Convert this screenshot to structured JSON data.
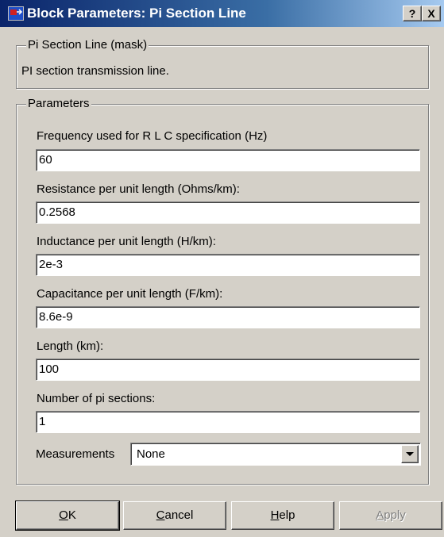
{
  "window": {
    "title": "Block Parameters: Pi Section Line",
    "icon": "simulink-block-icon",
    "help_label": "?",
    "close_label": "X"
  },
  "mask_group": {
    "title": "Pi Section Line (mask)",
    "description": "PI section transmission line."
  },
  "params_group": {
    "title": "Parameters",
    "fields": [
      {
        "label": "Frequency used for R L C specification (Hz)",
        "value": "60"
      },
      {
        "label": "Resistance per unit length (Ohms/km):",
        "value": "0.2568"
      },
      {
        "label": "Inductance per unit length (H/km):",
        "value": "2e-3"
      },
      {
        "label": "Capacitance per unit length (F/km):",
        "value": "8.6e-9"
      },
      {
        "label": "Length (km):",
        "value": "100"
      },
      {
        "label": "Number of pi sections:",
        "value": "1"
      }
    ],
    "measurements": {
      "label": "Measurements",
      "value": "None"
    }
  },
  "buttons": {
    "ok": {
      "underline": "O",
      "rest": "K"
    },
    "cancel": {
      "underline": "C",
      "rest": "ancel"
    },
    "help": {
      "underline": "H",
      "rest": "elp"
    },
    "apply": {
      "underline": "A",
      "rest": "pply"
    }
  }
}
